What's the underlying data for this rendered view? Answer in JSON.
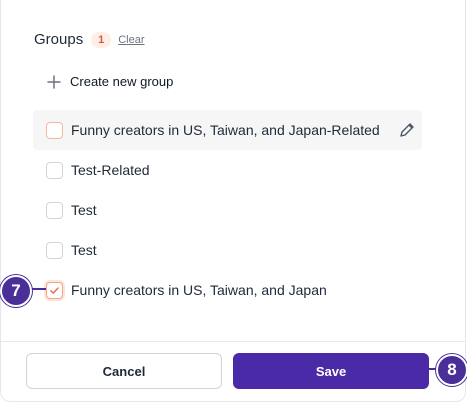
{
  "groups": {
    "title": "Groups",
    "count": "1",
    "clear_label": "Clear",
    "create_label": "Create new group",
    "items": [
      {
        "label": "Funny creators in US, Taiwan, and Japan-Related",
        "checked": false,
        "hovered": true
      },
      {
        "label": "Test-Related",
        "checked": false
      },
      {
        "label": "Test",
        "checked": false
      },
      {
        "label": "Test",
        "checked": false
      },
      {
        "label": "Funny creators in US, Taiwan, and Japan",
        "checked": true
      }
    ]
  },
  "callouts": {
    "first": "7",
    "second": "8"
  },
  "footer": {
    "cancel_label": "Cancel",
    "save_label": "Save"
  },
  "colors": {
    "accent": "#4a2aa6",
    "badge_text": "#d9593a",
    "badge_bg": "#fdeee8",
    "check": "#e8704a"
  }
}
